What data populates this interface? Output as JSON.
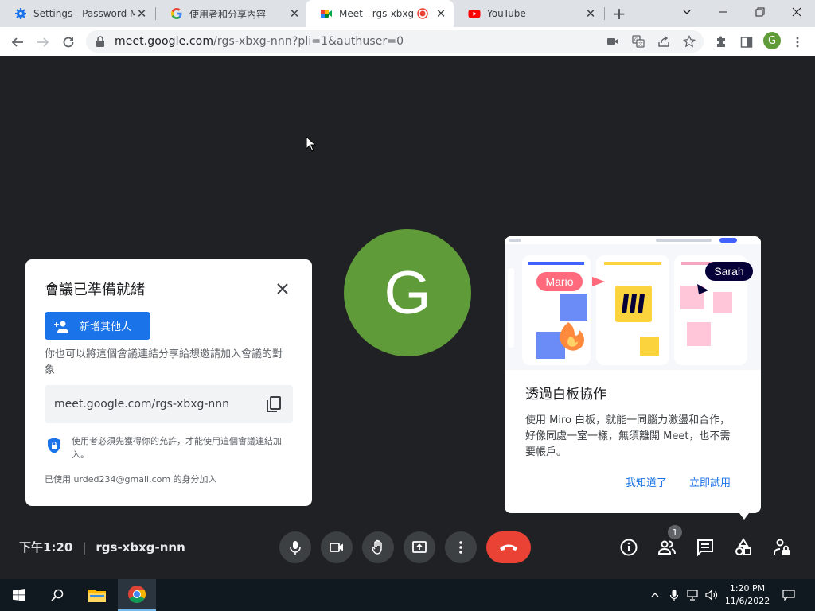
{
  "browser": {
    "tabs": [
      {
        "title": "Settings - Password Ma",
        "favicon": "gear-icon",
        "active": false
      },
      {
        "title": "使用者和分享內容",
        "favicon": "google-icon",
        "active": false
      },
      {
        "title": "Meet - rgs-xbxg-n",
        "favicon": "meet-icon",
        "active": true,
        "recording": true
      },
      {
        "title": "YouTube",
        "favicon": "youtube-icon",
        "active": false
      }
    ],
    "new_tab_label": "+",
    "url_host": "meet.google.com",
    "url_path": "/rgs-xbxg-nnn?pli=1&authuser=0",
    "profile_initial": "G"
  },
  "meet": {
    "participant_initial": "G",
    "ready_card": {
      "title": "會議已準備就緒",
      "add_button": "新增其他人",
      "description": "你也可以將這個會議連結分享給想邀請加入會議的對象",
      "link": "meet.google.com/rgs-xbxg-nnn",
      "permission_note": "使用者必須先獲得你的允許，才能使用這個會議連結加入。",
      "joined_as": "已使用 urded234@gmail.com 的身分加入"
    },
    "miro_card": {
      "title": "透過白板協作",
      "description": "使用 Miro 白板，就能一同腦力激盪和合作，好像同處一室一樣，無須離開 Meet，也不需要帳戶。",
      "dismiss": "我知道了",
      "try_now": "立即試用",
      "illustration_labels": {
        "mario": "Mario",
        "sarah": "Sarah"
      }
    },
    "bottom_bar": {
      "time": "下午1:20",
      "separator": "|",
      "meeting_code": "rgs-xbxg-nnn",
      "participants_count": "1"
    }
  },
  "taskbar": {
    "clock_time": "1:20 PM",
    "clock_date": "11/6/2022"
  },
  "colors": {
    "meet_bg": "#202124",
    "avatar_green": "#5f9c39",
    "primary_blue": "#1a73e8",
    "end_call_red": "#ea4335"
  }
}
